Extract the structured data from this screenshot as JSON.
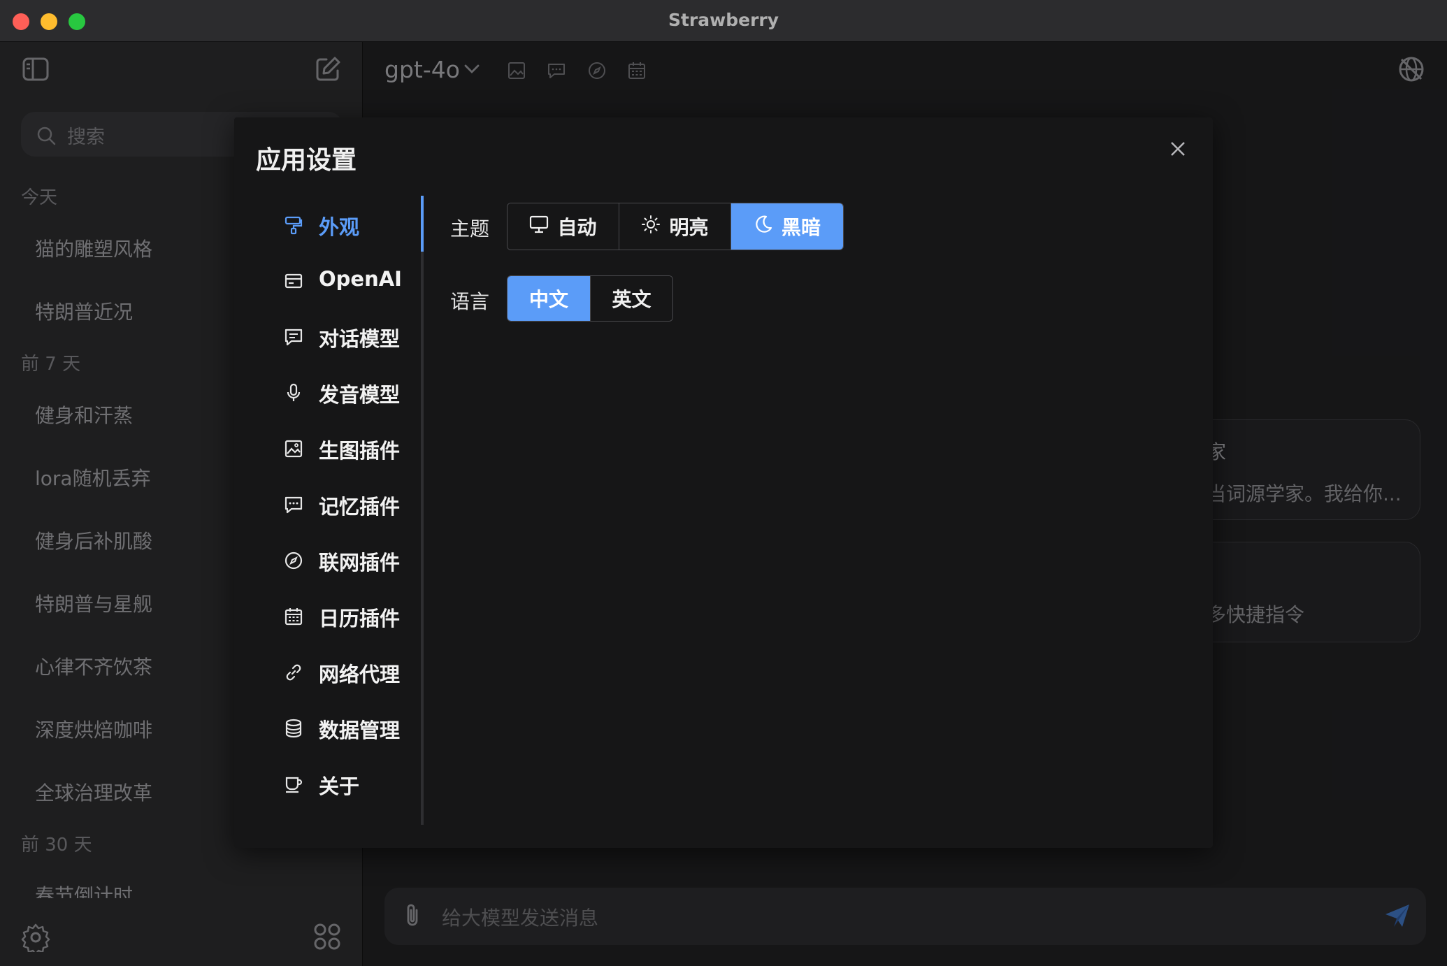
{
  "window": {
    "title": "Strawberry"
  },
  "sidebar": {
    "search_placeholder": "搜索",
    "sections": [
      {
        "label": "今天",
        "items": [
          "猫的雕塑风格",
          "特朗普近况"
        ]
      },
      {
        "label": "前 7 天",
        "items": [
          "健身和汗蒸",
          "lora随机丢弃",
          "健身后补肌酸",
          "特朗普与星舰",
          "心律不齐饮茶",
          "深度烘焙咖啡",
          "全球治理改革"
        ]
      },
      {
        "label": "前 30 天",
        "items": [
          "春节倒计时"
        ]
      }
    ]
  },
  "header": {
    "model": "gpt-4o"
  },
  "prompt_cards": [
    {
      "title": "家",
      "desc": "当词源学家。我给你..."
    },
    {
      "title": "",
      "desc": "多快捷指令"
    }
  ],
  "input": {
    "placeholder": "给大模型发送消息"
  },
  "dialog": {
    "title": "应用设置",
    "nav": [
      {
        "label": "外观",
        "icon": "paint-roller-icon",
        "active": true
      },
      {
        "label": "OpenAI",
        "icon": "card-icon"
      },
      {
        "label": "对话模型",
        "icon": "chat-square-icon"
      },
      {
        "label": "发音模型",
        "icon": "microphone-icon"
      },
      {
        "label": "生图插件",
        "icon": "image-icon"
      },
      {
        "label": "记忆插件",
        "icon": "chat-dots-icon"
      },
      {
        "label": "联网插件",
        "icon": "compass-icon"
      },
      {
        "label": "日历插件",
        "icon": "calendar-icon"
      },
      {
        "label": "网络代理",
        "icon": "link-icon"
      },
      {
        "label": "数据管理",
        "icon": "database-icon"
      },
      {
        "label": "关于",
        "icon": "cup-icon"
      }
    ],
    "theme": {
      "label": "主题",
      "options": [
        "自动",
        "明亮",
        "黑暗"
      ],
      "selected": "黑暗"
    },
    "language": {
      "label": "语言",
      "options": [
        "中文",
        "英文"
      ],
      "selected": "中文"
    }
  },
  "colors": {
    "accent": "#5b9cf8",
    "dialog_bg": "#161617",
    "sidebar_bg": "#2a2a2c"
  }
}
